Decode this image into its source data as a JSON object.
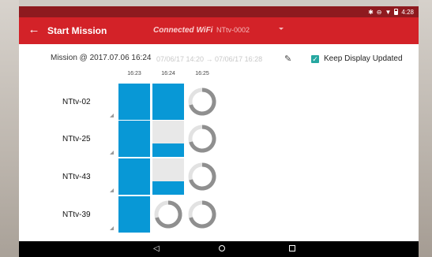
{
  "status": {
    "time": "4:28",
    "icons": [
      "bluetooth-icon",
      "dnd-icon",
      "wifi-icon",
      "battery-icon"
    ]
  },
  "appbar": {
    "back_icon": "arrow-back-icon",
    "title": "Start Mission",
    "connection_label": "Connected WiFi",
    "connection_value": "NTtv-0002"
  },
  "mission": {
    "name": "Mission @ 2017.07.06 16:24",
    "range": "07/06/17 14:20 → 07/06/17 16:28",
    "keep_display_label": "Keep Display Updated",
    "keep_display_checked": true
  },
  "time_columns": [
    "16:23",
    "16:24",
    "16:25"
  ],
  "rows": [
    {
      "label": "NTtv-02",
      "cells": [
        {
          "state": "full"
        },
        {
          "state": "full"
        },
        {
          "state": "loading"
        }
      ]
    },
    {
      "label": "NTtv-25",
      "cells": [
        {
          "state": "full"
        },
        {
          "state": "partial",
          "level": 0.38
        },
        {
          "state": "loading"
        }
      ]
    },
    {
      "label": "NTtv-43",
      "cells": [
        {
          "state": "full"
        },
        {
          "state": "partial",
          "level": 0.38
        },
        {
          "state": "loading"
        }
      ]
    },
    {
      "label": "NTtv-39",
      "cells": [
        {
          "state": "full"
        },
        {
          "state": "loading"
        },
        {
          "state": "loading"
        }
      ]
    }
  ],
  "colors": {
    "statusbar": "#8e1a1f",
    "appbar": "#d32228",
    "data_fill": "#0898d6",
    "checkbox": "#26a7a0"
  },
  "navbar": {
    "icons": [
      "nav-back-icon",
      "nav-home-icon",
      "nav-recents-icon"
    ]
  }
}
